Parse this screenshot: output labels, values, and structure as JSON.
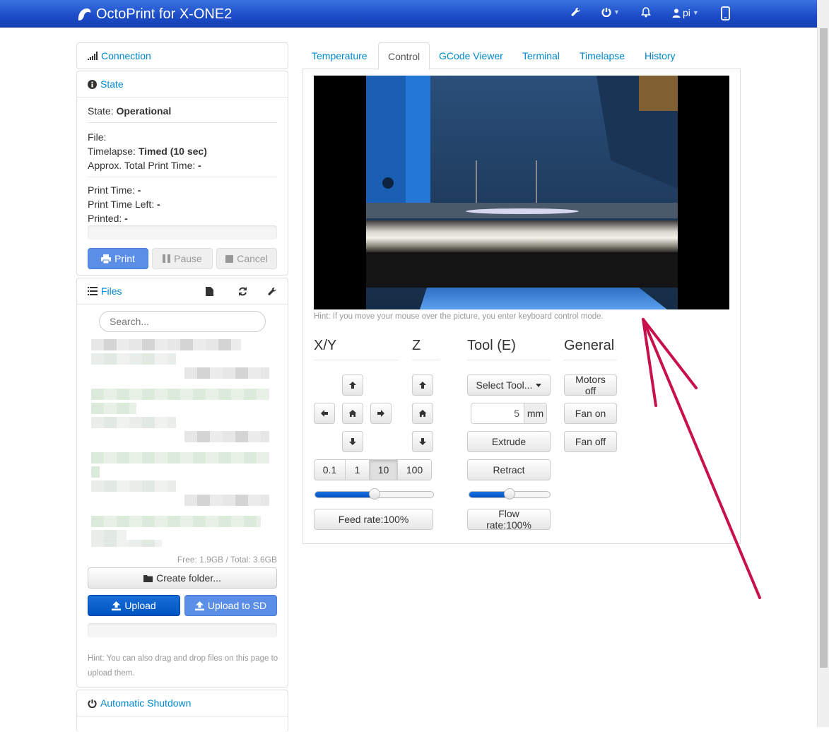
{
  "navbar": {
    "brand": "OctoPrint for X-ONE2",
    "user": "pi",
    "icons": [
      "wrench-icon",
      "power-icon",
      "bell-icon",
      "user-icon",
      "mobile-icon"
    ]
  },
  "sidebar": {
    "connection": {
      "title": "Connection"
    },
    "state": {
      "title": "State",
      "state_label": "State:",
      "state_value": "Operational",
      "file_label": "File:",
      "timelapse_label": "Timelapse:",
      "timelapse_value": "Timed (10 sec)",
      "approx_label": "Approx. Total Print Time:",
      "approx_value": "-",
      "print_time_label": "Print Time:",
      "print_time_value": "-",
      "time_left_label": "Print Time Left:",
      "time_left_value": "-",
      "printed_label": "Printed:",
      "printed_value": "-",
      "print_button": "Print",
      "pause_button": "Pause",
      "cancel_button": "Cancel"
    },
    "files": {
      "title": "Files",
      "search_placeholder": "Search...",
      "storage": "Free: 1.9GB / Total: 3.6GB",
      "create_folder": "Create folder...",
      "upload": "Upload",
      "upload_sd": "Upload to SD",
      "hint": "Hint: You can also drag and drop files on this page to upload them."
    },
    "shutdown": {
      "title": "Automatic Shutdown"
    }
  },
  "tabs": [
    "Temperature",
    "Control",
    "GCode Viewer",
    "Terminal",
    "Timelapse",
    "History"
  ],
  "control": {
    "webcam_hint": "Hint: If you move your mouse over the picture, you enter keyboard control mode.",
    "xy_title": "X/Y",
    "z_title": "Z",
    "tool_title": "Tool (E)",
    "general_title": "General",
    "step_sizes": [
      "0.1",
      "1",
      "10",
      "100"
    ],
    "selected_step": "10",
    "feed_rate": "Feed rate:100%",
    "feed_rate_value": 0.5,
    "select_tool": "Select Tool...",
    "extrude_amount": "5",
    "extrude_unit": "mm",
    "extrude": "Extrude",
    "retract": "Retract",
    "flow_rate": "Flow rate:100%",
    "flow_rate_value": 0.5,
    "motors_off": "Motors off",
    "fan_on": "Fan on",
    "fan_off": "Fan off"
  },
  "colors": {
    "navbar": "#1c4cc8",
    "link": "#0088cc",
    "primary": "#5b8ee6",
    "annotation_arrow": "#c8104a"
  }
}
